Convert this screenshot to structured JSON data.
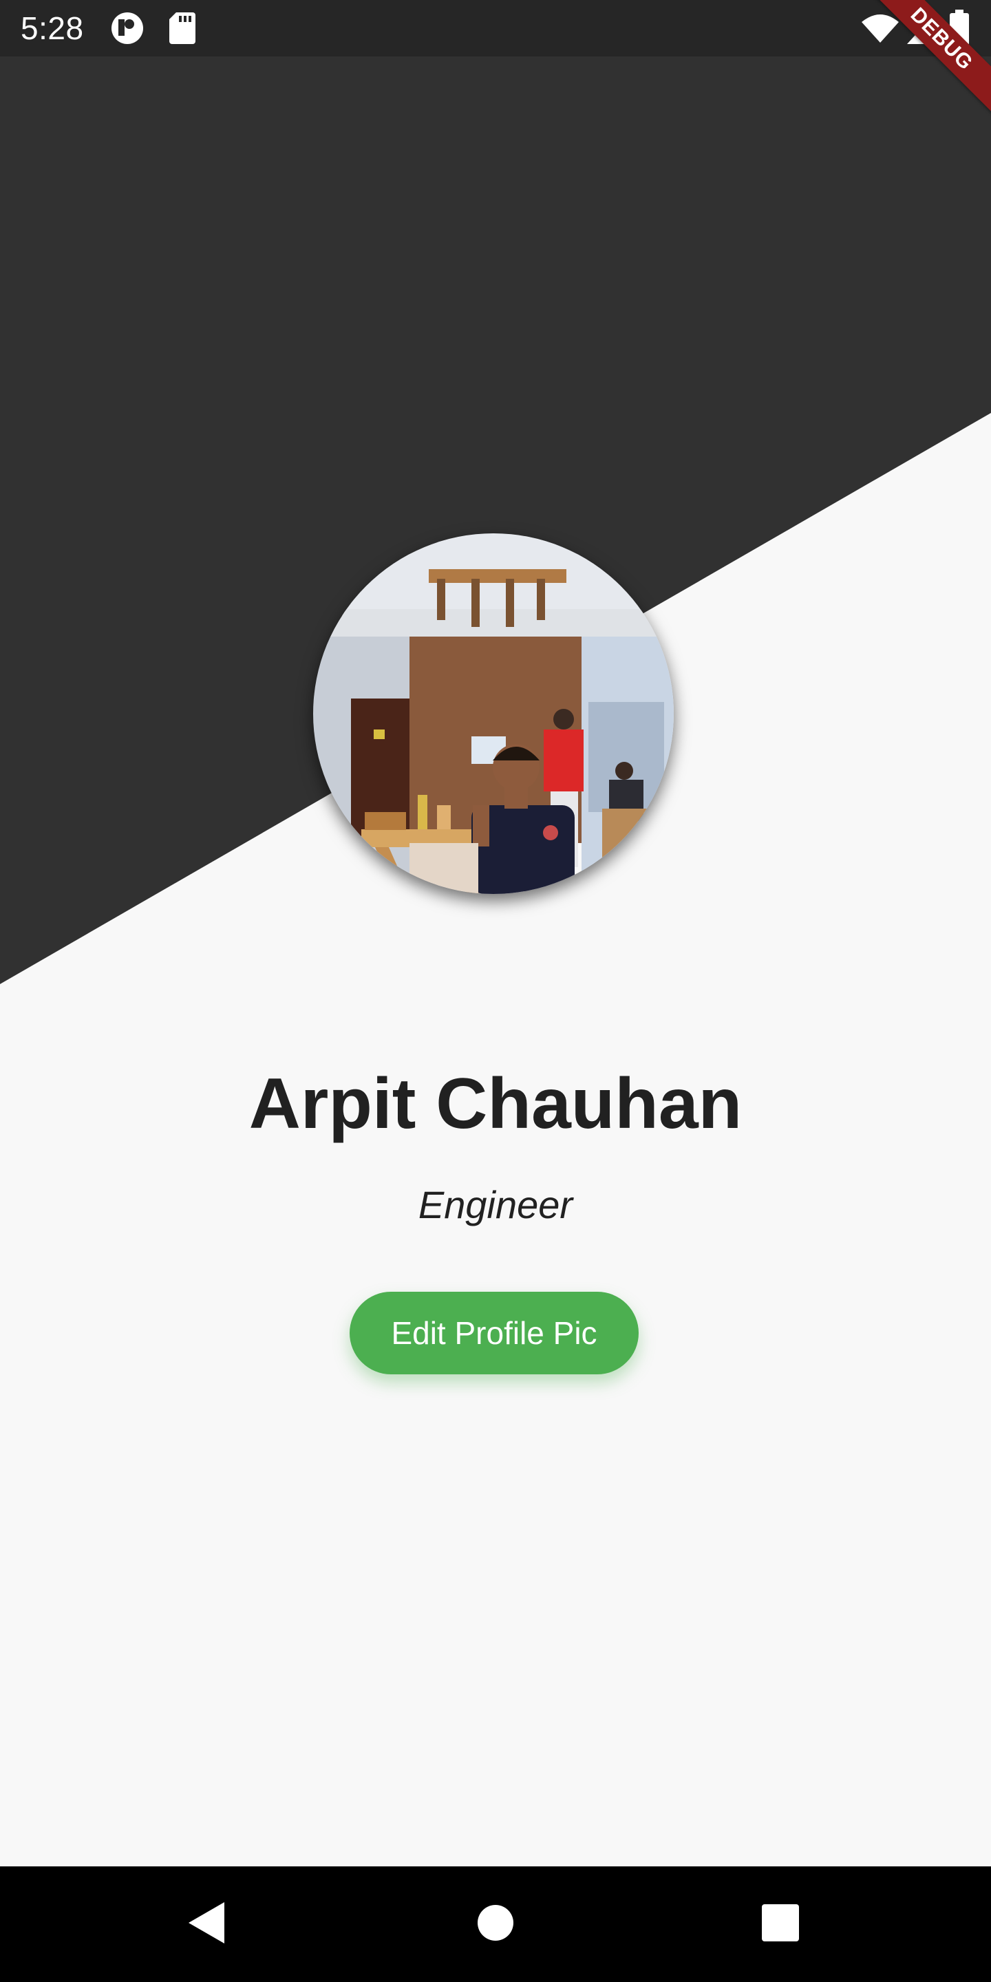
{
  "status_bar": {
    "time": "5:28",
    "icons": [
      "app-logo-icon",
      "sd-card-icon",
      "wifi-icon",
      "signal-icon",
      "battery-icon"
    ]
  },
  "debug_banner": {
    "label": "DEBUG",
    "color": "#8d1b1b"
  },
  "profile": {
    "name": "Arpit Chauhan",
    "role": "Engineer",
    "edit_button_label": "Edit Profile Pic"
  },
  "nav_bar": {
    "buttons": [
      "back-icon",
      "home-icon",
      "recents-icon"
    ]
  },
  "colors": {
    "dark_bg": "#313131",
    "light_bg": "#f8f8f8",
    "button_green": "#4caf50",
    "text_dark": "#212121"
  }
}
